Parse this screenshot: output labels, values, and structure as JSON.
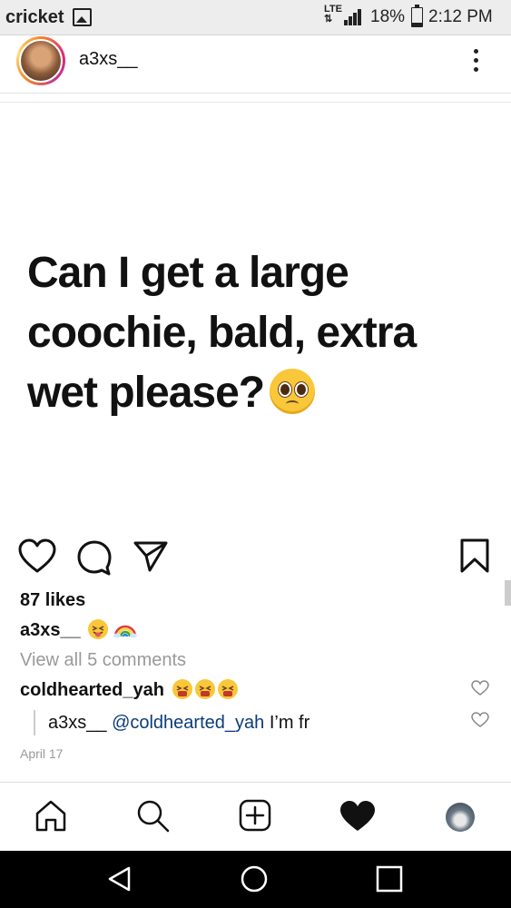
{
  "status_bar": {
    "carrier": "cricket",
    "network": "LTE",
    "battery": "18%",
    "battery_level": 0.18,
    "time": "2:12 PM"
  },
  "post": {
    "username": "a3xs__",
    "image_text": [
      "Can I get a large",
      "coochie, bald, extra",
      "wet please?"
    ],
    "image_emoji": "pleading-face",
    "likes": "87 likes",
    "caption_user": "a3xs__",
    "caption_emojis": [
      "squinting-tongue-face",
      "rainbow"
    ],
    "view_all_comments": "View all 5 comments",
    "comments": [
      {
        "user": "coldhearted_yah",
        "emojis": [
          "tired-face",
          "tired-face",
          "tired-face"
        ]
      },
      {
        "user": "a3xs__",
        "mention": "@coldhearted_yah",
        "text": " I’m fr"
      }
    ],
    "date": "April 17"
  },
  "icons": {
    "like": "heart-outline-icon",
    "comment": "comment-icon",
    "share": "paper-plane-icon",
    "save": "bookmark-icon"
  },
  "bottom_nav": [
    "home-icon",
    "search-icon",
    "add-post-icon",
    "activity-heart-icon",
    "profile-icon"
  ],
  "android_nav": [
    "back-icon",
    "home-circle-icon",
    "recents-square-icon"
  ],
  "colors": {
    "mention": "#0b3c78",
    "muted": "#999999",
    "story_ring": "#dd2a7b"
  }
}
